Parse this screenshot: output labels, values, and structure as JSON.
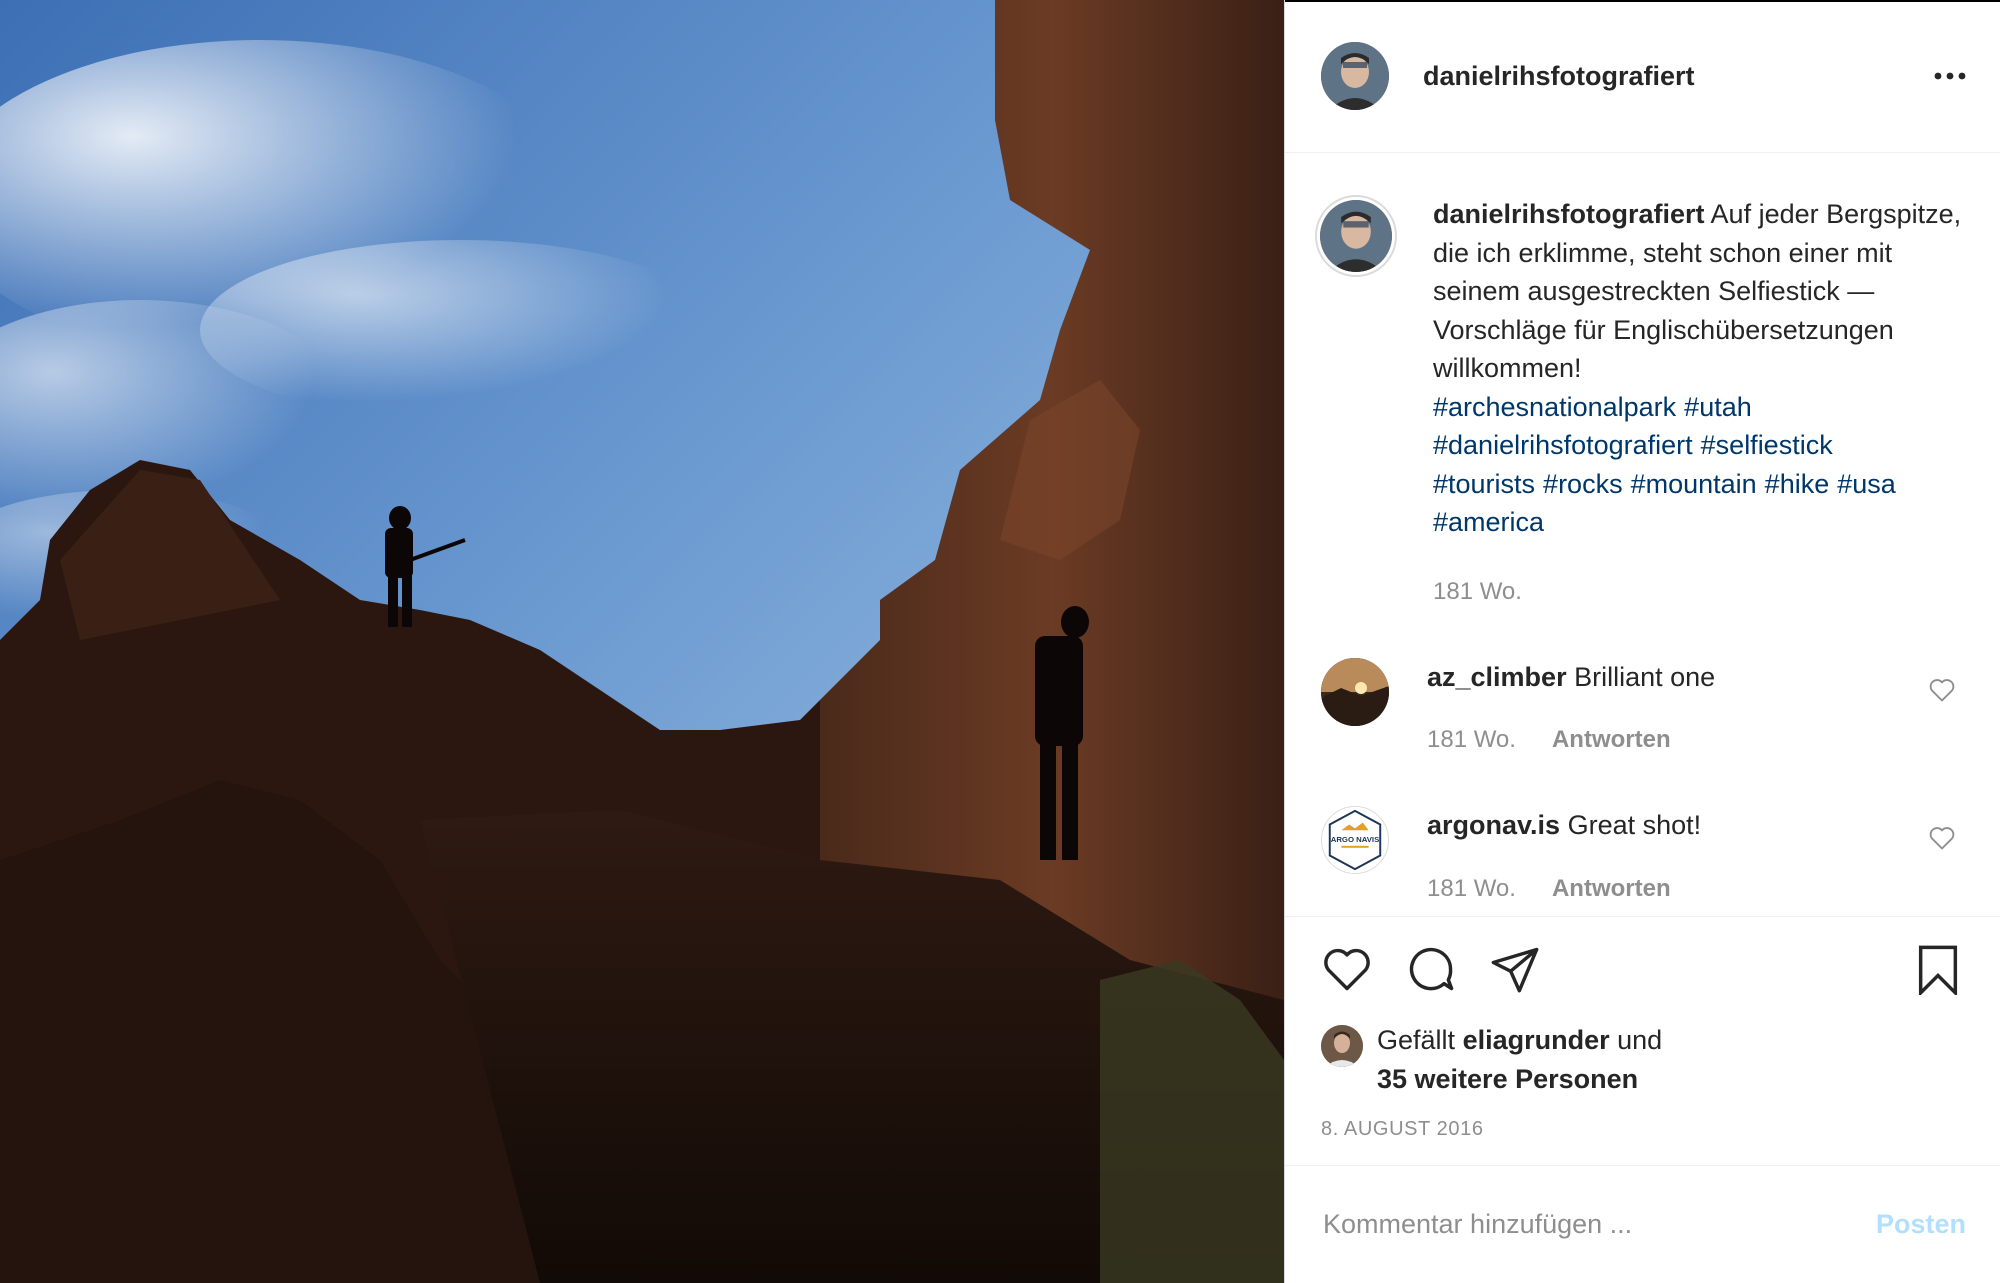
{
  "post": {
    "author": "danielrihsfotografiert",
    "caption_text": "Auf jeder Bergspitze, die ich erklimme, steht schon einer mit seinem ausgestreckten Selfiestick — Vorschläge für Englischübersetzungen willkommen!",
    "hashtags": [
      "#archesnationalpark",
      "#utah",
      "#danielrihsfotografiert",
      "#selfiestick",
      "#tourists",
      "#rocks",
      "#mountain",
      "#hike",
      "#usa",
      "#america"
    ],
    "caption_age": "181 Wo."
  },
  "comments": [
    {
      "user": "az_climber",
      "text": "Brilliant one",
      "age": "181 Wo.",
      "reply_label": "Antworten"
    },
    {
      "user": "argonav.is",
      "text": "Great shot!",
      "age": "181 Wo.",
      "reply_label": "Antworten",
      "avatar_text": "ARGO NAVIS"
    }
  ],
  "likes": {
    "prefix": "Gefällt",
    "liker": "eliagrunder",
    "connector": "und",
    "others": "35 weitere Personen"
  },
  "date": "8. AUGUST 2016",
  "add_comment": {
    "placeholder": "Kommentar hinzufügen ...",
    "post_label": "Posten"
  },
  "icons": {
    "more": "more-horizontal-icon",
    "like": "heart-icon",
    "comment": "comment-bubble-icon",
    "share": "paper-plane-icon",
    "save": "bookmark-icon"
  },
  "colors": {
    "hashtag": "#00376b",
    "muted": "#8e8e8e",
    "post_disabled": "#b2dffc",
    "text": "#262626"
  }
}
